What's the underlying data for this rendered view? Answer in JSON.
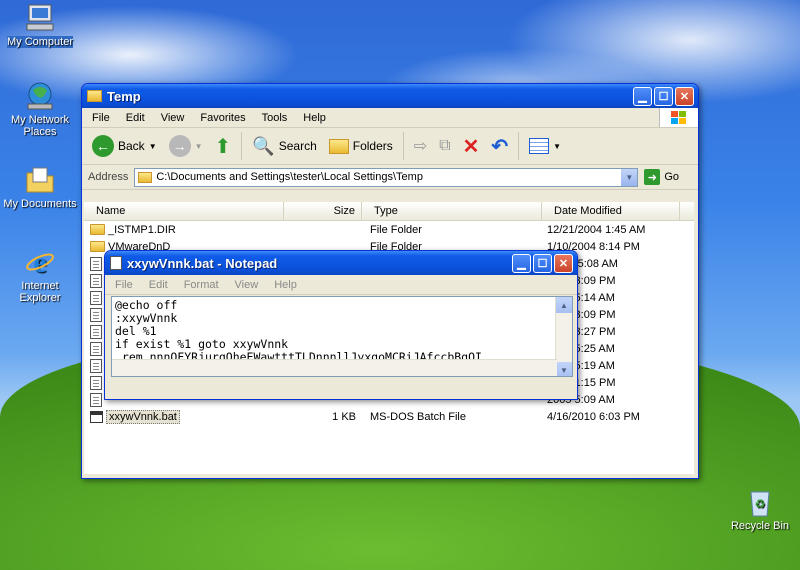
{
  "desktop": {
    "icons": [
      {
        "label": "My Computer"
      },
      {
        "label": "My Network Places"
      },
      {
        "label": "My Documents"
      },
      {
        "label": "Internet Explorer"
      },
      {
        "label": "Recycle Bin"
      }
    ]
  },
  "explorer": {
    "title": "Temp",
    "menu": [
      "File",
      "Edit",
      "View",
      "Favorites",
      "Tools",
      "Help"
    ],
    "toolbar": {
      "back": "Back",
      "search": "Search",
      "folders": "Folders"
    },
    "address": {
      "label": "Address",
      "value": "C:\\Documents and Settings\\tester\\Local Settings\\Temp",
      "go": "Go"
    },
    "columns": {
      "name": "Name",
      "size": "Size",
      "type": "Type",
      "date": "Date Modified"
    },
    "rows": [
      {
        "name": "_ISTMP1.DIR",
        "size": "",
        "type": "File Folder",
        "date": "12/21/2004 1:45 AM",
        "icon": "folder-icon"
      },
      {
        "name": "VMwareDnD",
        "size": "",
        "type": "File Folder",
        "date": "1/10/2004 8:14 PM",
        "icon": "folder-icon"
      },
      {
        "name": "",
        "size": "",
        "type": "",
        "date": "/2006 5:08 AM",
        "icon": "file-icon"
      },
      {
        "name": "",
        "size": "",
        "type": "",
        "date": "2005 3:09 PM",
        "icon": "file-icon"
      },
      {
        "name": "",
        "size": "",
        "type": "",
        "date": "2005 5:14 AM",
        "icon": "file-icon"
      },
      {
        "name": "",
        "size": "",
        "type": "",
        "date": "2005 3:09 PM",
        "icon": "file-icon"
      },
      {
        "name": "",
        "size": "",
        "type": "",
        "date": "2005 3:27 PM",
        "icon": "file-icon"
      },
      {
        "name": "",
        "size": "",
        "type": "",
        "date": "2005 5:25 AM",
        "icon": "file-icon"
      },
      {
        "name": "",
        "size": "",
        "type": "",
        "date": "2005 5:19 AM",
        "icon": "file-icon"
      },
      {
        "name": "",
        "size": "",
        "type": "",
        "date": "2005 1:15 PM",
        "icon": "file-icon"
      },
      {
        "name": "",
        "size": "",
        "type": "",
        "date": "2005 5:09 AM",
        "icon": "file-icon"
      },
      {
        "name": "xxywVnnk.bat",
        "size": "1 KB",
        "type": "MS-DOS Batch File",
        "date": "4/16/2010 6:03 PM",
        "icon": "bat-icon"
      }
    ]
  },
  "notepad": {
    "title": "xxywVnnk.bat - Notepad",
    "menu": [
      "File",
      "Edit",
      "Format",
      "View",
      "Help"
    ],
    "content": "@echo off\n:xxywVnnk\ndel %1\nif exist %1 goto xxywVnnk\n rem nnnOFYRjurqQheEWawtttTLDnnnllJyxqoMCRiJAfccbBqOI"
  },
  "colors": {
    "titlebar": "#0a4fd8",
    "close_button": "#c9432a",
    "selection": "#316ac5"
  }
}
